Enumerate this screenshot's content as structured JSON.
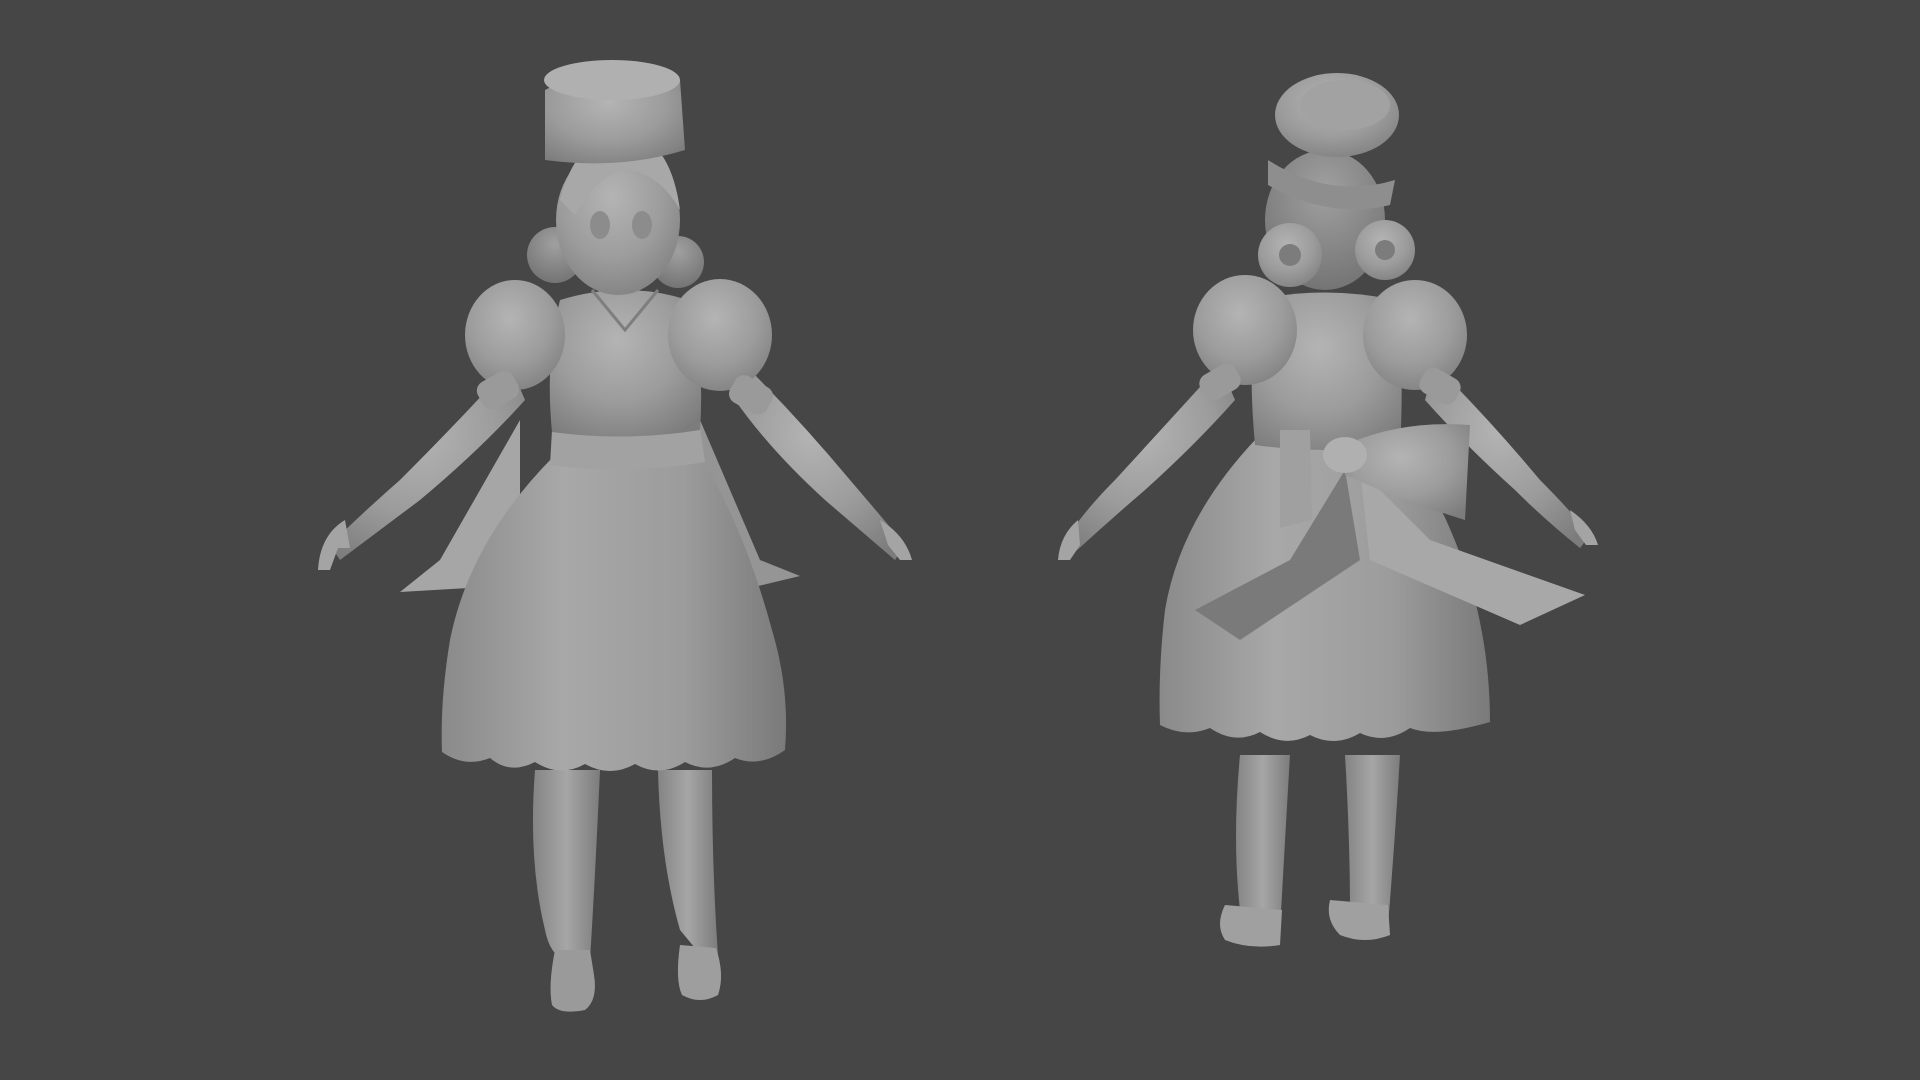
{
  "scene": {
    "kind": "3d-viewport-render",
    "background_color": "#464646",
    "model_color": "#9a9a9a",
    "views": [
      {
        "name": "front-view",
        "character": "doll-girl-in-dress-with-tall-hat"
      },
      {
        "name": "back-view",
        "character": "doll-girl-in-dress-with-tall-hat"
      }
    ]
  }
}
